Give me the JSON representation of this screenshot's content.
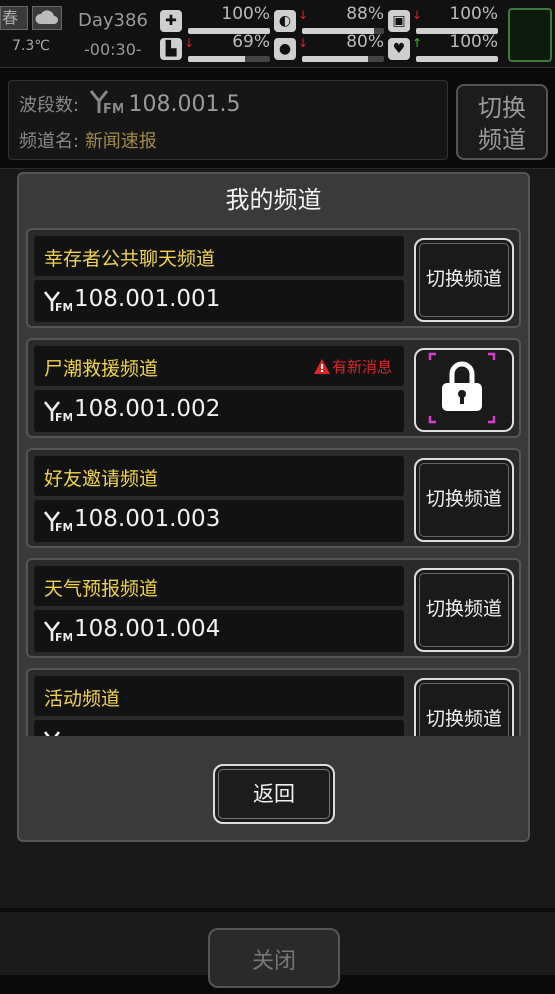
{
  "status": {
    "season": "春",
    "temperature": "7.3℃",
    "day": "Day386",
    "time": "-00:30-",
    "stats": [
      {
        "name": "health",
        "icon": "medkit-icon",
        "glyph": "✚",
        "trend": "",
        "value": "100%",
        "level": 1.0
      },
      {
        "name": "hunger",
        "icon": "stomach-icon",
        "glyph": "◐",
        "trend": "↓",
        "value": "88%",
        "level": 0.88
      },
      {
        "name": "bladder",
        "icon": "toilet-icon",
        "glyph": "▣",
        "trend": "↓",
        "value": "100%",
        "level": 1.0
      },
      {
        "name": "stamina",
        "icon": "boot-icon",
        "glyph": "▙",
        "trend": "↓",
        "value": "69%",
        "level": 0.69
      },
      {
        "name": "thirst",
        "icon": "water-drop-icon",
        "glyph": "●",
        "trend": "↓",
        "value": "80%",
        "level": 0.8
      },
      {
        "name": "mood",
        "icon": "heart-icon",
        "glyph": "♥",
        "trend": "↑",
        "value": "100%",
        "level": 1.0
      }
    ]
  },
  "header": {
    "band_label": "波段数:",
    "band_value": "108.001.5",
    "channel_label": "频道名:",
    "channel_value": "新闻速报",
    "switch_label_1": "切换",
    "switch_label_2": "频道"
  },
  "modal": {
    "title": "我的频道",
    "fm_tag": "FM",
    "channels": [
      {
        "name": "幸存者公共聊天频道",
        "frequency": "108.001.001",
        "button": "切换频道",
        "locked": false,
        "alert": ""
      },
      {
        "name": "尸潮救援频道",
        "frequency": "108.001.002",
        "button": "",
        "locked": true,
        "alert": "有新消息"
      },
      {
        "name": "好友邀请频道",
        "frequency": "108.001.003",
        "button": "切换频道",
        "locked": false,
        "alert": ""
      },
      {
        "name": "天气预报频道",
        "frequency": "108.001.004",
        "button": "切换频道",
        "locked": false,
        "alert": ""
      },
      {
        "name": "活动频道",
        "frequency": "",
        "button": "切换频道",
        "locked": false,
        "alert": ""
      }
    ],
    "back_label": "返回"
  },
  "footer": {
    "close_label": "关闭"
  },
  "colors": {
    "channel_name": "#f0d34a",
    "alert": "#e02525",
    "lock_accent": "#d63cc8"
  }
}
